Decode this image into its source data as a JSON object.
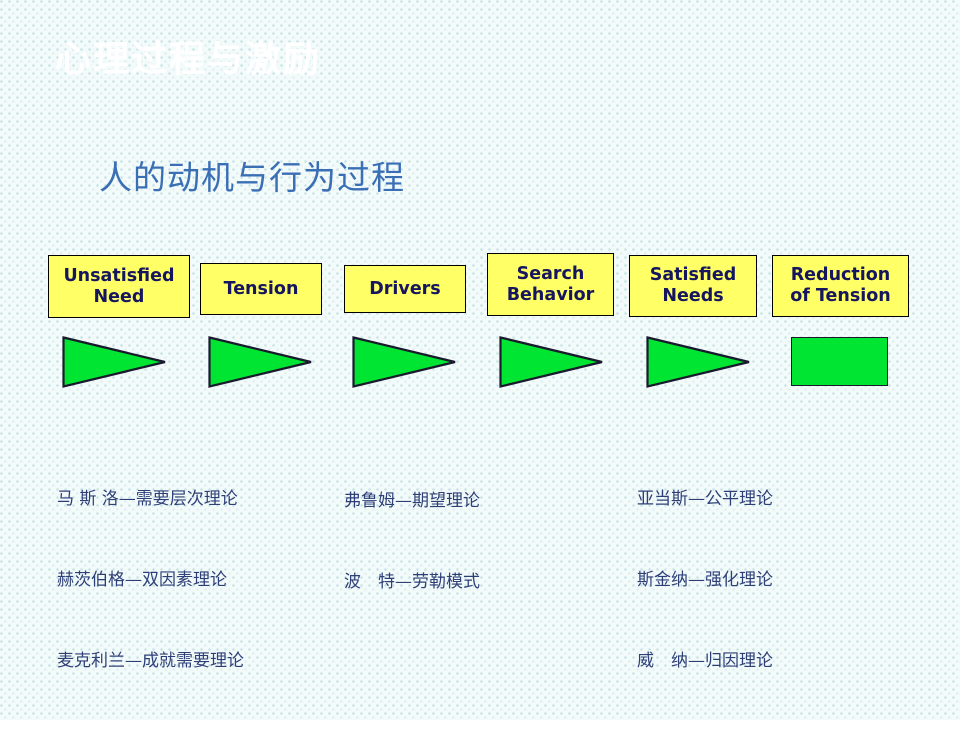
{
  "slide": {
    "header_title": "心理过程与激励",
    "main_title": "人的动机与行为过程",
    "background_color": "#f2fafa",
    "dot_color": "#a0cdd2",
    "title_color": "#3a6fb5",
    "header_color": "#ffffff"
  },
  "flow": {
    "box_fill": "#ffff66",
    "box_text_color": "#16165e",
    "arrow_fill": "#00e432",
    "arrow_stroke": "#1a1a2e",
    "boxes": [
      {
        "label": "Unsatisfied\nNeed"
      },
      {
        "label": "Tension"
      },
      {
        "label": "Drivers"
      },
      {
        "label": "Search\nBehavior"
      },
      {
        "label": "Satisfied\nNeeds"
      },
      {
        "label": "Reduction\nof Tension"
      }
    ],
    "connectors": [
      {
        "shape": "triangle-right"
      },
      {
        "shape": "triangle-right"
      },
      {
        "shape": "triangle-right"
      },
      {
        "shape": "triangle-right"
      },
      {
        "shape": "triangle-right"
      },
      {
        "shape": "rectangle"
      }
    ]
  },
  "theories": {
    "column1": [
      "马 斯 洛—需要层次理论",
      "赫茨伯格—双因素理论",
      "麦克利兰—成就需要理论"
    ],
    "column2": [
      "弗鲁姆—期望理论",
      "波　特—劳勒模式"
    ],
    "column3": [
      "亚当斯—公平理论",
      "斯金纳—强化理论",
      "威　纳—归因理论"
    ]
  }
}
